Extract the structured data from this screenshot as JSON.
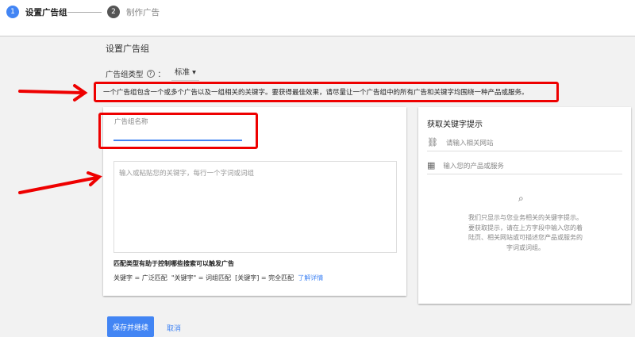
{
  "steps": [
    {
      "num": "1",
      "label": "设置广告组"
    },
    {
      "num": "2",
      "label": "制作广告"
    }
  ],
  "section_title": "设置广告组",
  "ad_group_type": {
    "label": "广告组类型",
    "help_icon": "help-circle-icon",
    "separator": "：",
    "value": "标准"
  },
  "info_text": "一个广告组包含一个或多个广告以及一组相关的关键字。要获得最佳效果，请尽量让一个广告组中的所有广告和关键字均围绕一种产品或服务。",
  "name_field": {
    "placeholder": "广告组名称"
  },
  "keywords_field": {
    "placeholder": "输入或粘贴您的关键字，每行一个字词或词组"
  },
  "match_title": "匹配类型有助于控制哪些搜索可以触发广告",
  "match_text": "关键字 = 广泛匹配  \"关键字\" = 词组匹配  [关键字] = 完全匹配",
  "learn_more": "了解详情",
  "suggest": {
    "title": "获取关键字提示",
    "website_placeholder": "请输入相关网站",
    "product_placeholder": "输入您的产品或服务",
    "hint": "我们只显示与您业务相关的关键字提示。要获取提示，请在上方字段中输入您的着陆页、相关网站或可描述您产品或服务的字词或词组。"
  },
  "buttons": {
    "save": "保存并继续",
    "cancel": "取消"
  },
  "colors": {
    "accent": "#4285f4",
    "annotation": "#e00000"
  }
}
